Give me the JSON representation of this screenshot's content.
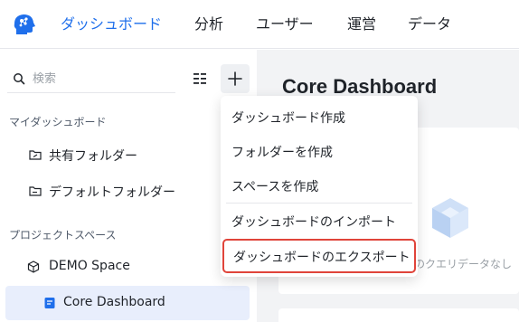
{
  "colors": {
    "accent": "#1f6feb",
    "highlight": "#e0443a"
  },
  "nav": {
    "logo_icon": "brain-head-logo",
    "items": [
      {
        "label": "ダッシュボード",
        "active": true
      },
      {
        "label": "分析"
      },
      {
        "label": "ユーザー"
      },
      {
        "label": "運営"
      },
      {
        "label": "データ"
      }
    ]
  },
  "sidebar": {
    "search_placeholder": "検索",
    "sections": [
      {
        "title": "マイダッシュボード",
        "items": [
          {
            "label": "共有フォルダー",
            "icon": "folder-share-icon"
          },
          {
            "label": "デフォルトフォルダー",
            "icon": "folder-icon"
          }
        ]
      },
      {
        "title": "プロジェクトスペース",
        "items": [
          {
            "label": "DEMO Space",
            "icon": "cube-icon"
          },
          {
            "label": "Core Dashboard",
            "icon": "dashboard-doc-icon",
            "selected": true
          }
        ]
      }
    ]
  },
  "main": {
    "title": "Core Dashboard",
    "empty_text": "のクエリデータなし"
  },
  "menu": {
    "items": [
      {
        "label": "ダッシュボード作成"
      },
      {
        "label": "フォルダーを作成"
      },
      {
        "label": "スペースを作成"
      },
      {
        "label": "ダッシュボードのインポート"
      },
      {
        "label": "ダッシュボードのエクスポート",
        "highlighted": true
      }
    ]
  }
}
